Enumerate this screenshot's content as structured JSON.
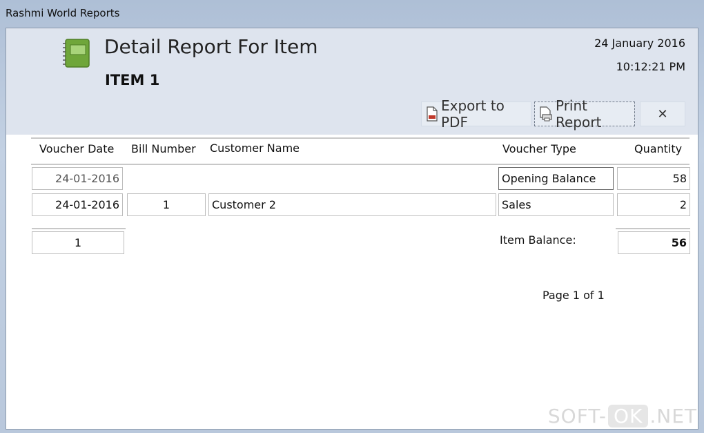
{
  "window": {
    "title": "Rashmi World Reports"
  },
  "header": {
    "report_title": "Detail Report For Item",
    "item_name": "ITEM 1",
    "date": "24 January 2016",
    "time": "10:12:21 PM",
    "icon": "report-book-icon"
  },
  "toolbar": {
    "export_label": "Export to PDF",
    "print_label": "Print Report",
    "close_label": "✕"
  },
  "columns": {
    "voucher_date": "Voucher Date",
    "bill_number": "Bill Number",
    "customer_name": "Customer Name",
    "voucher_type": "Voucher Type",
    "quantity": "Quantity"
  },
  "rows": [
    {
      "voucher_date": "24-01-2016",
      "bill_number": "",
      "customer_name": "",
      "voucher_type": "Opening Balance",
      "quantity": "58"
    },
    {
      "voucher_date": "24-01-2016",
      "bill_number": "1",
      "customer_name": "Customer 2",
      "voucher_type": "Sales",
      "quantity": "2"
    }
  ],
  "footer": {
    "count": "1",
    "balance_label": "Item Balance:",
    "balance_value": "56",
    "page": "Page 1 of 1"
  },
  "watermark": {
    "left": "SOFT-",
    "ok": "OK",
    "right": ".NET"
  },
  "colors": {
    "header_bg": "#dee4ee",
    "frame_border": "#8a98ab",
    "icon_green": "#7cb342"
  }
}
